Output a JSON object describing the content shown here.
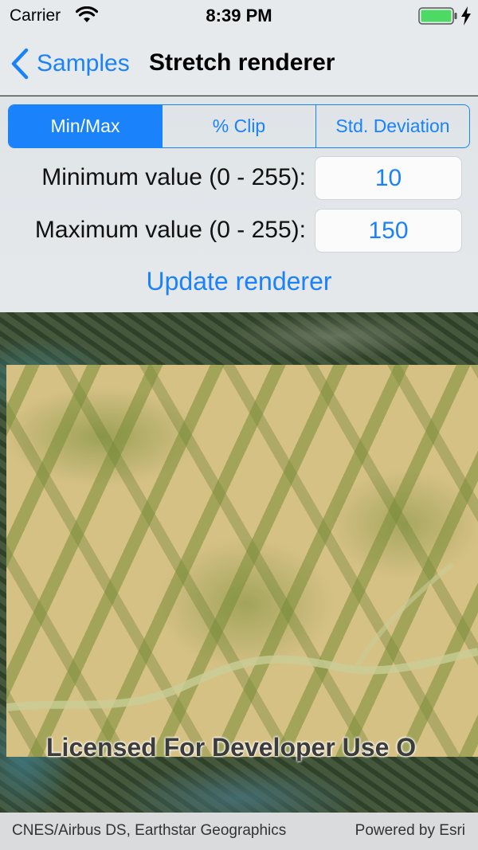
{
  "status_bar": {
    "carrier": "Carrier",
    "time": "8:39 PM",
    "battery_color": "#4cd964"
  },
  "nav": {
    "back_label": "Samples",
    "title": "Stretch renderer"
  },
  "stretch_type": {
    "options": [
      "Min/Max",
      "% Clip",
      "Std. Deviation"
    ],
    "selected": "Min/Max"
  },
  "parameters": {
    "minimum_label": "Minimum value (0 - 255):",
    "minimum_value": "10",
    "maximum_label": "Maximum value (0 - 255):",
    "maximum_value": "150"
  },
  "update_button_label": "Update renderer",
  "map": {
    "watermark": "Licensed For Developer Use O"
  },
  "attribution": {
    "text": "CNES/Airbus DS, Earthstar Geographics",
    "powered_by": "Powered by Esri"
  },
  "colors": {
    "accent": "#1a82fb",
    "bar_background": "#e6eaec",
    "overlay_tan": "#d6c185"
  }
}
